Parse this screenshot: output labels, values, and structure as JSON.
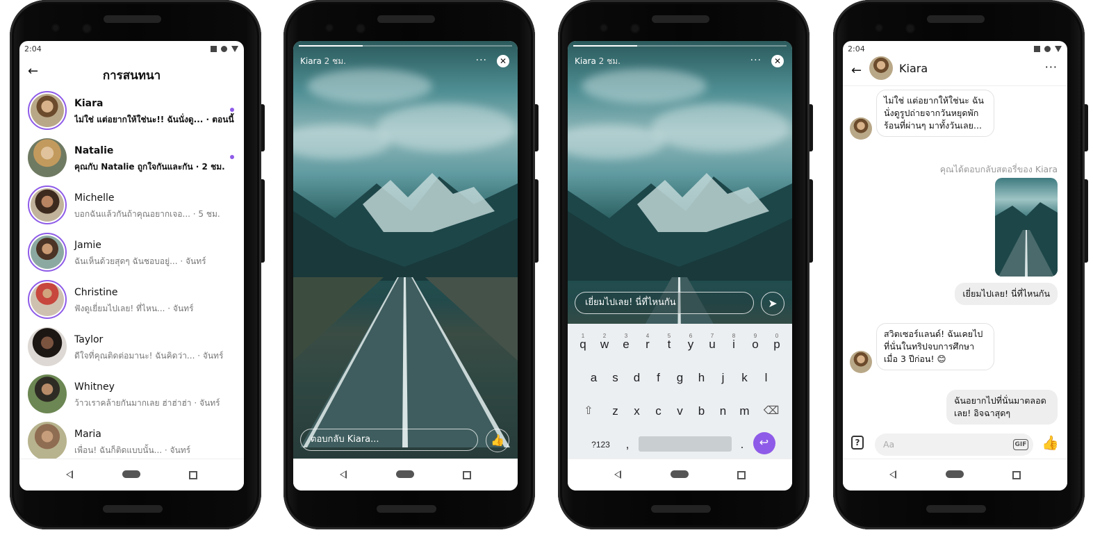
{
  "status": {
    "time": "2:04"
  },
  "conversations": {
    "title": "การสนทนา",
    "items": [
      {
        "name": "Kiara",
        "snippet": "ไม่ใช่ แต่อยากให้ใช่นะ!! ฉันนั่งดู... · ตอนนี้"
      },
      {
        "name": "Natalie",
        "snippet": "คุณกับ Natalie ถูกใจกันและกัน · 2 ชม."
      },
      {
        "name": "Michelle",
        "snippet": "บอกฉันแล้วกันถ้าคุณอยากเจอ... · 5 ชม."
      },
      {
        "name": "Jamie",
        "snippet": "ฉันเห็นด้วยสุดๆ ฉันชอบอยู่... · จันทร์"
      },
      {
        "name": "Christine",
        "snippet": "ฟังดูเยี่ยมไปเลย! ที่ไหน... · จันทร์"
      },
      {
        "name": "Taylor",
        "snippet": "ดีใจที่คุณติดต่อมานะ! ฉันคิดว่า... · จันทร์"
      },
      {
        "name": "Whitney",
        "snippet": "ว้าวเราคล้ายกันมากเลย ฮ่าฮ่าฮ่า · จันทร์"
      },
      {
        "name": "Maria",
        "snippet": "เพื่อน! ฉันก็ติดแบบนั้น... · จันทร์"
      }
    ]
  },
  "story": {
    "user": "Kiara",
    "time": "2 ชม.",
    "more": "···",
    "close": "✕",
    "reply_placeholder": "ตอบกลับ Kiara...",
    "like": "👍",
    "reply_typed": "เยี่ยมไปเลย! นี่ที่ไหนกัน",
    "send": "➤",
    "progress": 0.3
  },
  "keyboard": {
    "row1": [
      "q",
      "w",
      "e",
      "r",
      "t",
      "y",
      "u",
      "i",
      "o",
      "p"
    ],
    "row1_nums": [
      "1",
      "2",
      "3",
      "4",
      "5",
      "6",
      "7",
      "8",
      "9",
      "0"
    ],
    "row2": [
      "a",
      "s",
      "d",
      "f",
      "g",
      "h",
      "j",
      "k",
      "l"
    ],
    "row3": [
      "z",
      "x",
      "c",
      "v",
      "b",
      "n",
      "m"
    ],
    "shift": "⇧",
    "backspace": "⌫",
    "symbols": "?123",
    "comma": ",",
    "period": ".",
    "enter": "↩"
  },
  "chat": {
    "name": "Kiara",
    "back": "←",
    "more": "···",
    "msg1": "ไม่ใช่ แต่อยากให้ใช่นะ ฉันนั่งดูรูปถ่ายจากวันหยุดพักร้อนที่ผ่านๆ มาทั้งวันเลย...",
    "story_reply_note": "คุณได้ตอบกลับสตอรี่ของ Kiara",
    "msg2": "เยี่ยมไปเลย! นี่ที่ไหนกัน",
    "msg3": "สวิตเซอร์แลนด์! ฉันเคยไปที่นั่นในทริปจบการศึกษาเมื่อ 3 ปีก่อน! 😊",
    "msg4": "ฉันอยากไปที่นั่นมาตลอดเลย! อิจฉาสุดๆ",
    "composer_placeholder": "Aa",
    "gif": "GIF",
    "like": "👍"
  }
}
